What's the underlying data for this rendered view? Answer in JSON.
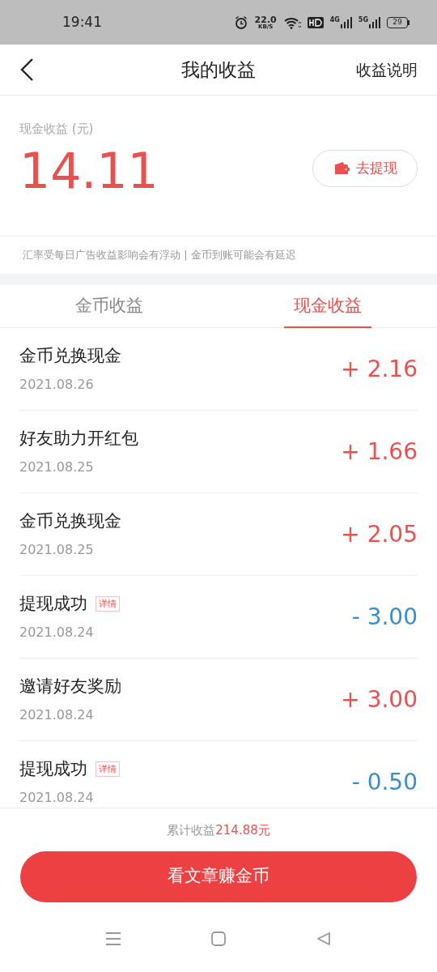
{
  "status_bar": {
    "time": "19:41",
    "net_speed": "22.0",
    "net_unit": "KB/S",
    "signals": [
      "4G",
      "5G"
    ],
    "battery": "29"
  },
  "header": {
    "title": "我的收益",
    "action": "收益说明"
  },
  "summary": {
    "label": "现金收益 (元)",
    "amount": "14.11",
    "button": "去提现"
  },
  "note": "汇率受每日广告收益影响会有浮动 | 金币到账可能会有延迟",
  "tabs": [
    {
      "label": "金币收益",
      "selected": false
    },
    {
      "label": "现金收益",
      "selected": true
    }
  ],
  "records": [
    {
      "kind": "income",
      "title": "金币兑换现金",
      "date": "2021.08.26",
      "amount": "+ 2.16"
    },
    {
      "kind": "income",
      "title": "好友助力开红包",
      "date": "2021.08.25",
      "amount": "+ 1.66"
    },
    {
      "kind": "income",
      "title": "金币兑换现金",
      "date": "2021.08.25",
      "amount": "+ 2.05"
    },
    {
      "kind": "withdrawal",
      "title": "提现成功",
      "badge": "详情",
      "date": "2021.08.24",
      "amount": "- 3.00"
    },
    {
      "kind": "income",
      "title": "邀请好友奖励",
      "date": "2021.08.24",
      "amount": "+ 3.00"
    },
    {
      "kind": "withdrawal",
      "title": "提现成功",
      "badge": "详情",
      "date": "2021.08.24",
      "amount": "- 0.50"
    }
  ],
  "total": {
    "label": "累计收益",
    "value": "214.88元"
  },
  "main_button": "看文章赚金币"
}
